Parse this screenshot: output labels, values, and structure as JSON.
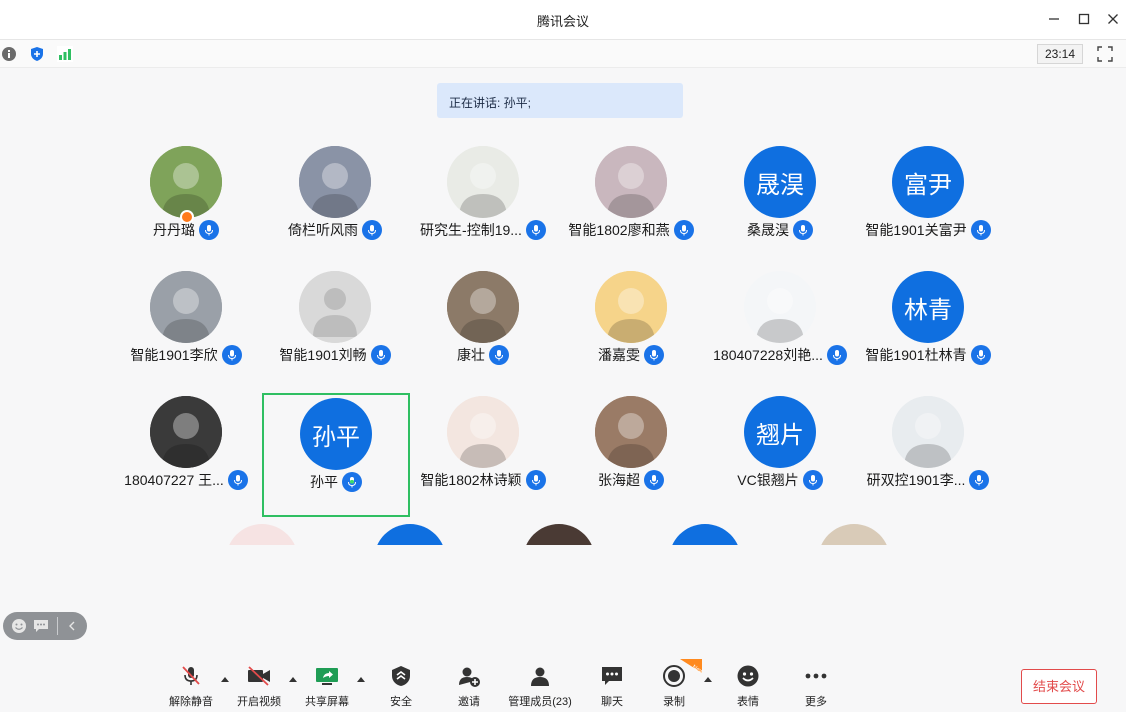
{
  "window": {
    "title": "腾讯会议"
  },
  "status": {
    "timer": "23:14"
  },
  "speaking": {
    "text": "正在讲话: 孙平;"
  },
  "participants": [
    {
      "name": "丹丹璐",
      "avatar": "photo",
      "color": "#7fa35a"
    },
    {
      "name": "倚栏听风雨",
      "avatar": "photo",
      "color": "#8a93a6"
    },
    {
      "name": "研究生-控制19...",
      "avatar": "photo",
      "color": "#e9ebe6"
    },
    {
      "name": "智能1802廖和燕",
      "avatar": "photo",
      "color": "#c9b7be"
    },
    {
      "name": "桑晟淏",
      "avatar": "text",
      "initials": "晟淏"
    },
    {
      "name": "智能1901关富尹",
      "avatar": "text",
      "initials": "富尹"
    },
    {
      "name": "智能1901李欣",
      "avatar": "photo",
      "color": "#9aa0a8"
    },
    {
      "name": "智能1901刘畅",
      "avatar": "default",
      "color": "#d9d9d9"
    },
    {
      "name": "康壮",
      "avatar": "photo",
      "color": "#8c7a68"
    },
    {
      "name": "潘嘉雯",
      "avatar": "photo",
      "color": "#f6d48a"
    },
    {
      "name": "180407228刘艳...",
      "avatar": "photo",
      "color": "#f4f6f8"
    },
    {
      "name": "智能1901杜林青",
      "avatar": "text",
      "initials": "林青"
    },
    {
      "name": "180407227 王...",
      "avatar": "photo",
      "color": "#3a3a3a"
    },
    {
      "name": "孙平",
      "avatar": "text",
      "initials": "孙平",
      "active": true
    },
    {
      "name": "智能1802林诗颖",
      "avatar": "photo",
      "color": "#f3e6e0"
    },
    {
      "name": "张海超",
      "avatar": "photo",
      "color": "#9a7b66"
    },
    {
      "name": "VC银翘片",
      "avatar": "text",
      "initials": "翘片"
    },
    {
      "name": "研双控1901李...",
      "avatar": "photo",
      "color": "#e8ecef"
    }
  ],
  "toolbar": {
    "mute": "解除静音",
    "video": "开启视频",
    "share": "共享屏幕",
    "security": "安全",
    "invite": "邀请",
    "members": "管理成员(23)",
    "chat": "聊天",
    "record": "录制",
    "reaction": "表情",
    "more": "更多",
    "end": "结束会议",
    "record_badge": "New"
  },
  "colors": {
    "accent": "#1a73e8",
    "avatar_blue": "#0f6fe0",
    "active_border": "#2fbf62",
    "end": "#e24b4b"
  }
}
